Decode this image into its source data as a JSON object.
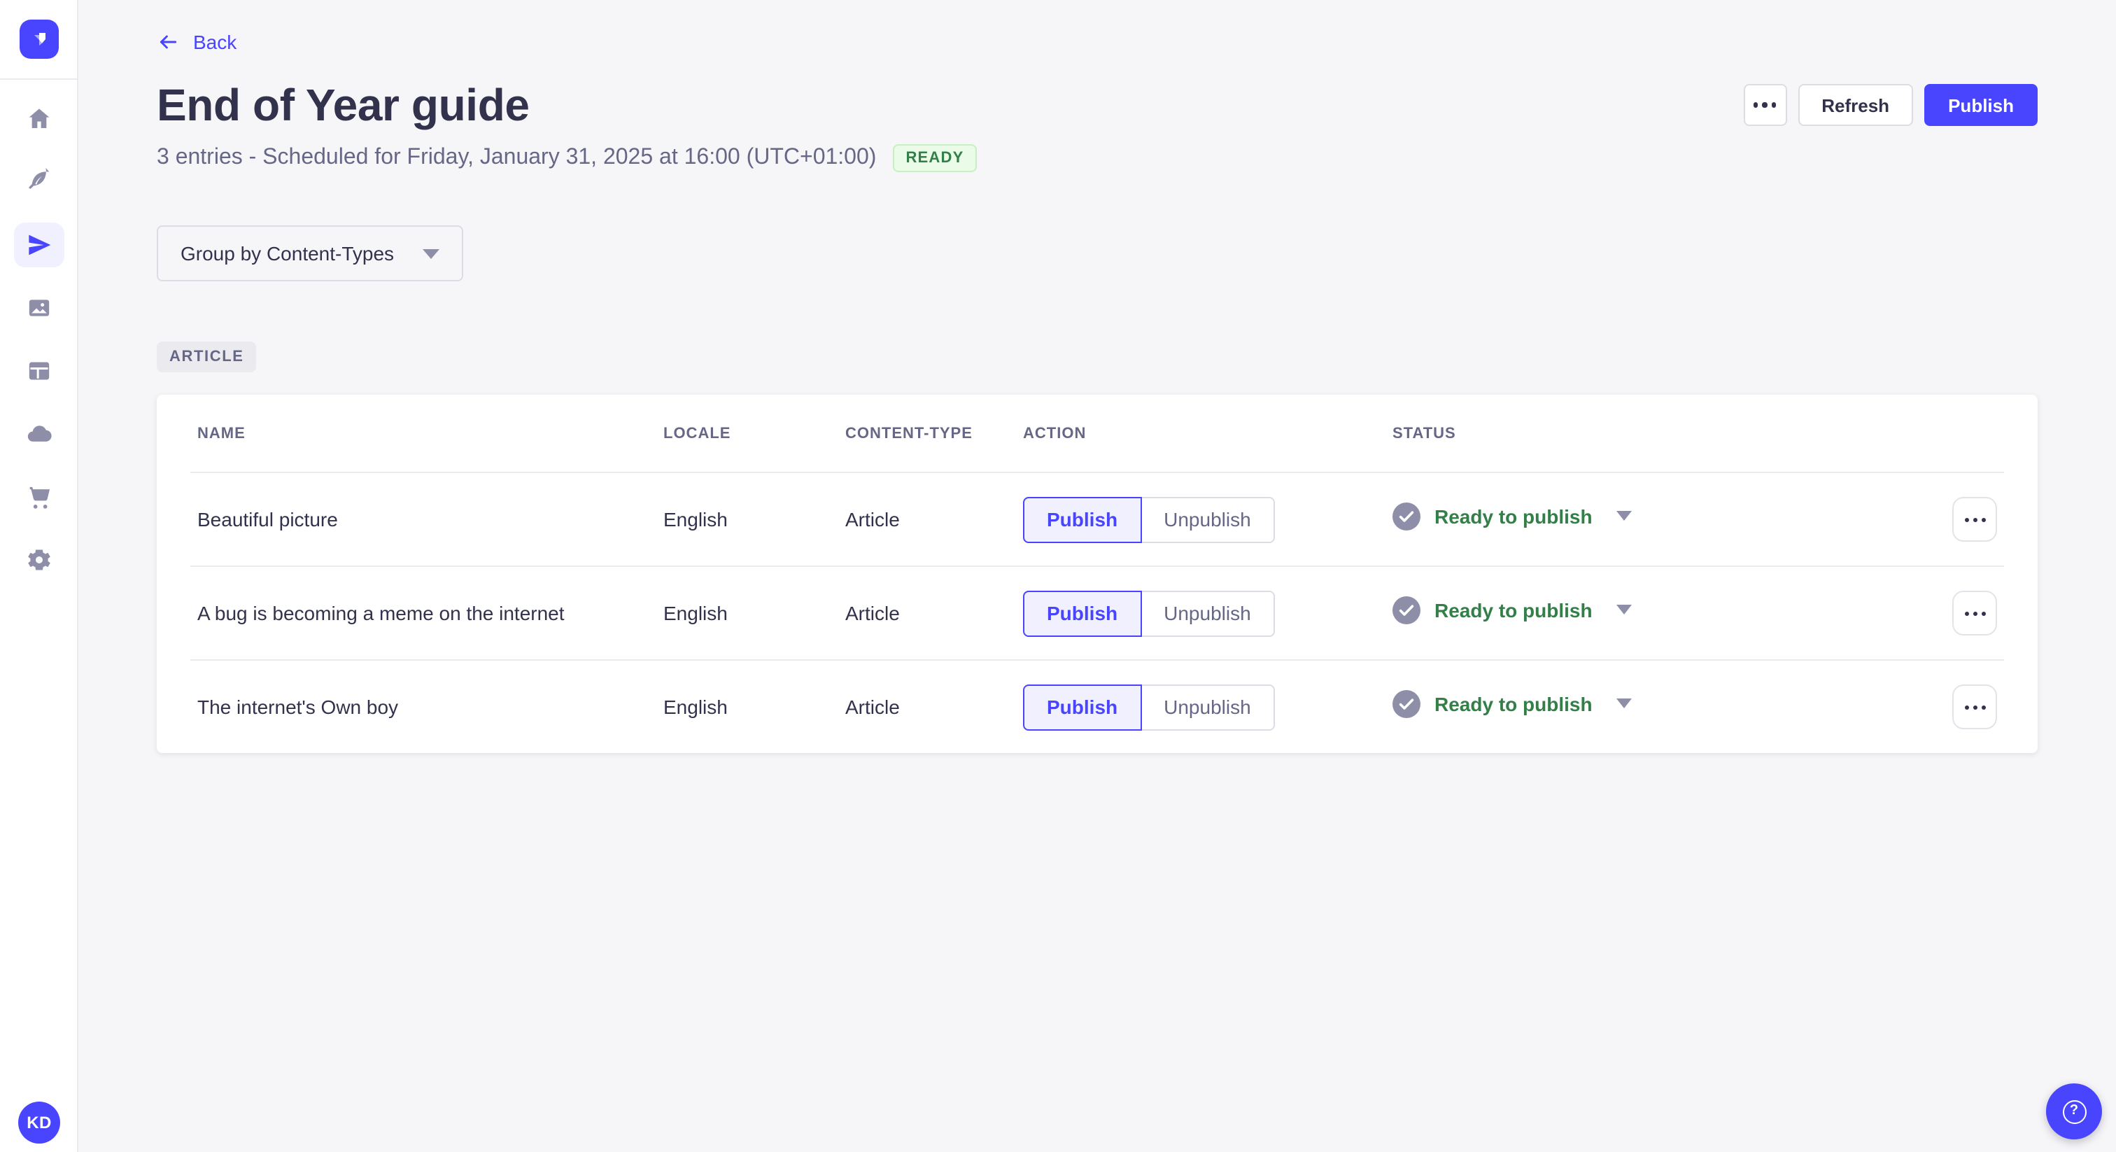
{
  "app": {
    "name": "Strapi admin",
    "accent_color": "#4945FF",
    "success_color": "#328048",
    "background_color": "#F6F6F9"
  },
  "sidebar": {
    "items": [
      {
        "id": "home",
        "icon": "home-icon"
      },
      {
        "id": "content-manager",
        "icon": "feather-icon"
      },
      {
        "id": "releases",
        "icon": "paper-plane-icon",
        "active": true
      },
      {
        "id": "media-library",
        "icon": "images-icon"
      },
      {
        "id": "content-type-builder",
        "icon": "layout-icon"
      },
      {
        "id": "deploy",
        "icon": "cloud-icon"
      },
      {
        "id": "marketplace",
        "icon": "cart-icon"
      },
      {
        "id": "settings",
        "icon": "gear-icon"
      }
    ],
    "avatar_initials": "KD"
  },
  "header": {
    "back_label": "Back",
    "title": "End of Year guide",
    "subtitle": "3 entries - Scheduled for Friday, January 31, 2025 at 16:00 (UTC+01:00)",
    "status_badge": "READY",
    "refresh_label": "Refresh",
    "publish_label": "Publish"
  },
  "toolbar": {
    "group_by_label": "Group by Content-Types"
  },
  "group": {
    "badge": "ARTICLE"
  },
  "table": {
    "headers": {
      "name": "NAME",
      "locale": "LOCALE",
      "content_type": "CONTENT-TYPE",
      "action": "ACTION",
      "status": "STATUS"
    },
    "rows": [
      {
        "name": "Beautiful picture",
        "locale": "English",
        "content_type": "Article",
        "publish_label": "Publish",
        "unpublish_label": "Unpublish",
        "status": "Ready to publish"
      },
      {
        "name": "A bug is becoming a meme on the internet",
        "locale": "English",
        "content_type": "Article",
        "publish_label": "Publish",
        "unpublish_label": "Unpublish",
        "status": "Ready to publish"
      },
      {
        "name": "The internet's Own boy",
        "locale": "English",
        "content_type": "Article",
        "publish_label": "Publish",
        "unpublish_label": "Unpublish",
        "status": "Ready to publish"
      }
    ]
  },
  "help": {
    "icon": "question-circle-icon",
    "glyph": "?"
  }
}
